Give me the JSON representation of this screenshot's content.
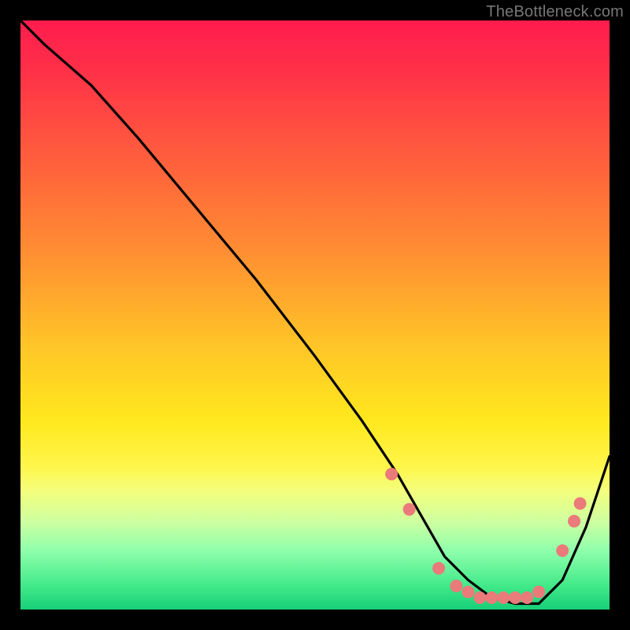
{
  "watermark": "TheBottleneck.com",
  "chart_data": {
    "type": "line",
    "title": "",
    "xlabel": "",
    "ylabel": "",
    "xlim": [
      0,
      100
    ],
    "ylim": [
      0,
      100
    ],
    "grid": false,
    "legend": false,
    "series": [
      {
        "name": "curve",
        "color": "#000000",
        "x": [
          0,
          4,
          12,
          20,
          30,
          40,
          50,
          58,
          64,
          68,
          72,
          76,
          80,
          84,
          88,
          92,
          96,
          100
        ],
        "y": [
          100,
          96,
          89,
          80,
          68,
          56,
          43,
          32,
          23,
          16,
          9,
          5,
          2,
          1,
          1,
          5,
          14,
          26
        ]
      }
    ],
    "markers": {
      "name": "dots",
      "color": "#eb7a7a",
      "radius": 8,
      "points": [
        {
          "x": 63,
          "y": 23
        },
        {
          "x": 66,
          "y": 17
        },
        {
          "x": 71,
          "y": 7
        },
        {
          "x": 74,
          "y": 4
        },
        {
          "x": 76,
          "y": 3
        },
        {
          "x": 78,
          "y": 2
        },
        {
          "x": 80,
          "y": 2
        },
        {
          "x": 82,
          "y": 2
        },
        {
          "x": 84,
          "y": 2
        },
        {
          "x": 86,
          "y": 2
        },
        {
          "x": 88,
          "y": 3
        },
        {
          "x": 92,
          "y": 10
        },
        {
          "x": 94,
          "y": 15
        },
        {
          "x": 95,
          "y": 18
        }
      ]
    }
  }
}
